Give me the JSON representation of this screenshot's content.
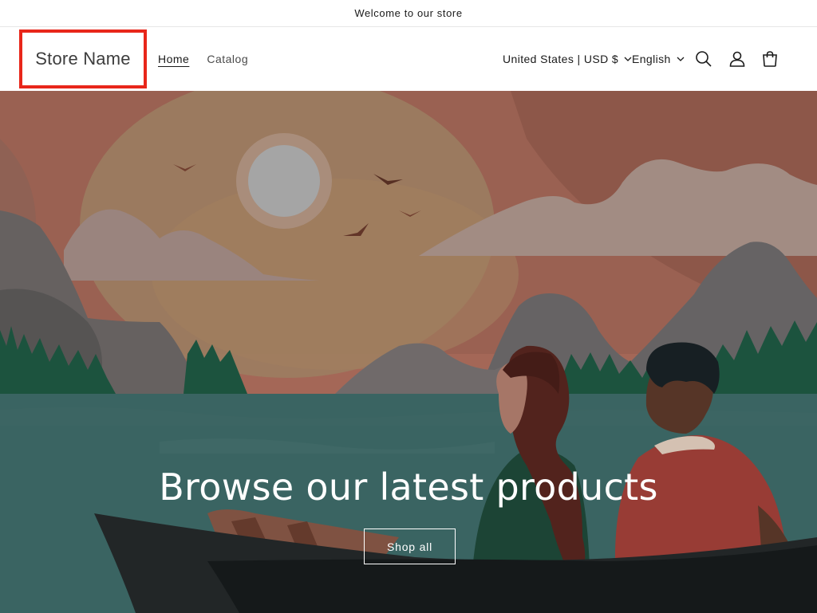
{
  "announcement": {
    "text": "Welcome to our store"
  },
  "header": {
    "logo_text": "Store Name",
    "nav": [
      {
        "label": "Home",
        "active": true
      },
      {
        "label": "Catalog",
        "active": false
      }
    ],
    "country_selector": "United States | USD $",
    "language_selector": "English",
    "icons": [
      "search-icon",
      "account-icon",
      "cart-icon"
    ],
    "highlight_color": "#e8261a"
  },
  "hero": {
    "heading": "Browse our latest products",
    "button_label": "Shop all"
  }
}
